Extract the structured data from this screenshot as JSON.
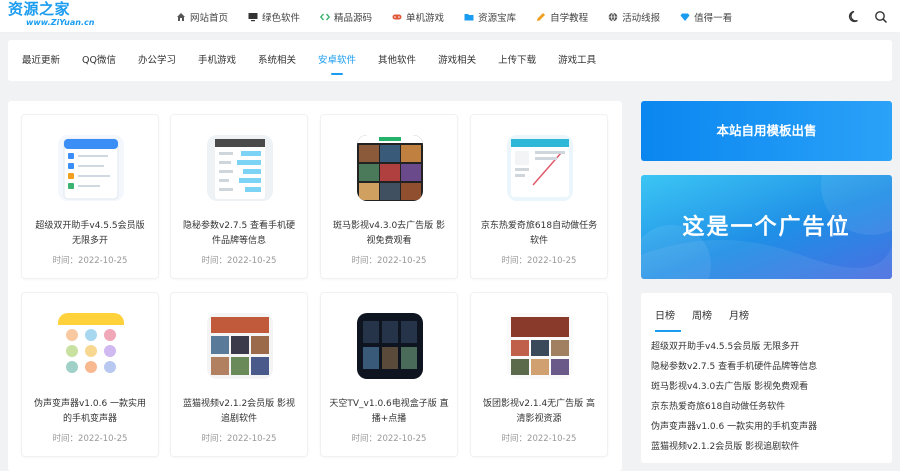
{
  "logo": {
    "name": "资源之家",
    "domain": "www.ZiYuan.cn"
  },
  "nav": [
    {
      "label": "网站首页",
      "icon": "home-icon"
    },
    {
      "label": "绿色软件",
      "icon": "monitor-icon"
    },
    {
      "label": "精品源码",
      "icon": "code-icon"
    },
    {
      "label": "单机游戏",
      "icon": "gamepad-icon"
    },
    {
      "label": "资源宝库",
      "icon": "folder-icon"
    },
    {
      "label": "自学教程",
      "icon": "pencil-icon"
    },
    {
      "label": "活动线报",
      "icon": "globe-icon"
    },
    {
      "label": "值得一看",
      "icon": "diamond-icon"
    }
  ],
  "colors": {
    "accent": "#1a9cf0",
    "nav_icons": [
      "#555555",
      "#333333",
      "#3cb371",
      "#e05a3a",
      "#1a9cf0",
      "#f0a020",
      "#555555",
      "#1a9cf0"
    ]
  },
  "categories": [
    "最近更新",
    "QQ微信",
    "办公学习",
    "手机游戏",
    "系统相关",
    "安卓软件",
    "其他软件",
    "游戏相关",
    "上传下载",
    "游戏工具"
  ],
  "active_category": "安卓软件",
  "cards": [
    {
      "title": "超级双开助手v4.5.5会员版 无限多开",
      "time": "时间：2022-10-25",
      "icon": "app-list-screenshot"
    },
    {
      "title": "隐秘参数v2.7.5 查看手机硬件品牌等信息",
      "time": "时间：2022-10-25",
      "icon": "settings-screenshot"
    },
    {
      "title": "斑马影视v4.3.0去广告版 影视免费观看",
      "time": "时间：2022-10-25",
      "icon": "movie-grid-screenshot"
    },
    {
      "title": "京东热爱奇旅618自动做任务软件",
      "time": "时间：2022-10-25",
      "icon": "task-screenshot"
    },
    {
      "title": "伪声变声器v1.0.6 一款实用的手机变声器",
      "time": "时间：2022-10-25",
      "icon": "voice-changer-screenshot"
    },
    {
      "title": "蓝猫视频v2.1.2会员版 影视追剧软件",
      "time": "时间：2022-10-25",
      "icon": "video-app-screenshot"
    },
    {
      "title": "天空TV_v1.0.6电视盒子版 直播+点播",
      "time": "时间：2022-10-25",
      "icon": "tv-app-screenshot"
    },
    {
      "title": "饭团影视v2.1.4无广告版 高清影视资源",
      "time": "时间：2022-10-25",
      "icon": "film-app-screenshot"
    }
  ],
  "banner_sale": "本站自用模板出售",
  "banner_ad": "这是一个广告位",
  "rank_tabs": [
    "日榜",
    "周榜",
    "月榜"
  ],
  "active_rank_tab": "日榜",
  "rank_items": [
    "超级双开助手v4.5.5会员版 无限多开",
    "隐秘参数v2.7.5 查看手机硬件品牌等信息",
    "斑马影视v4.3.0去广告版 影视免费观看",
    "京东热爱奇旅618自动做任务软件",
    "伪声变声器v1.0.6 一款实用的手机变声器",
    "蓝猫视频v2.1.2会员版 影视追剧软件"
  ]
}
